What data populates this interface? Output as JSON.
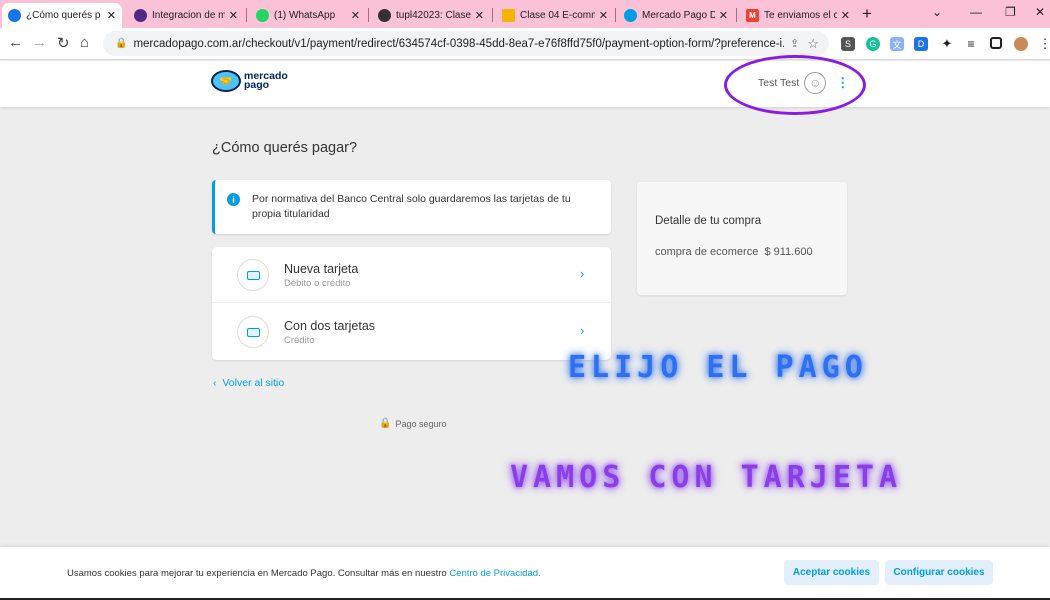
{
  "browser": {
    "tabs": [
      {
        "label": "¿Cómo querés p",
        "close": "✕",
        "favicon_color": "#1a73e8"
      },
      {
        "label": "Integracion de m",
        "close": "✕",
        "favicon_color": "#4e2a84"
      },
      {
        "label": "(1) WhatsApp",
        "close": "✕",
        "favicon_color": "#25d366"
      },
      {
        "label": "tupl42023: Clase",
        "close": "✕",
        "favicon_color": "#333333"
      },
      {
        "label": "Clase 04 E-comm",
        "close": "✕",
        "favicon_color": "#f4b400"
      },
      {
        "label": "Mercado Pago D",
        "close": "✕",
        "favicon_color": "#009ee3"
      },
      {
        "label": "Te enviamos el c",
        "close": "✕",
        "favicon_color": "#ea4335"
      }
    ],
    "new_tab": "+",
    "url": "mercadopago.com.ar/checkout/v1/payment/redirect/634574cf-0398-45dd-8ea7-e76f8ffd75f0/payment-option-form/?preference-i..."
  },
  "header": {
    "logo_line1": "mercado",
    "logo_line2": "pago",
    "user_name": "Test Test"
  },
  "main": {
    "title": "¿Cómo querés pagar?",
    "notice": "Por normativa del Banco Central solo guardaremos las tarjetas de tu propia titularidad",
    "options": [
      {
        "title": "Nueva tarjeta",
        "subtitle": "Débito o crédito"
      },
      {
        "title": "Con dos tarjetas",
        "subtitle": "Crédito"
      }
    ],
    "back_link": "Volver al sitio",
    "secure_label": "Pago seguro"
  },
  "summary": {
    "heading": "Detalle de tu compra",
    "item": "compra de ecomerce",
    "amount": "$ 911.600"
  },
  "overlay": {
    "text1": "ELIJO EL PAGO",
    "text2": "VAMOS CON TARJETA"
  },
  "cookies": {
    "text": "Usamos cookies para mejorar tu experiencia en Mercado Pago. Consultar más en nuestro",
    "link": "Centro de Privacidad.",
    "accept": "Aceptar cookies",
    "configure": "Configurar cookies"
  },
  "colors": {
    "brand": "#009ee3",
    "highlight": "#8a1be6",
    "tabbar": "#fbc1d6"
  }
}
